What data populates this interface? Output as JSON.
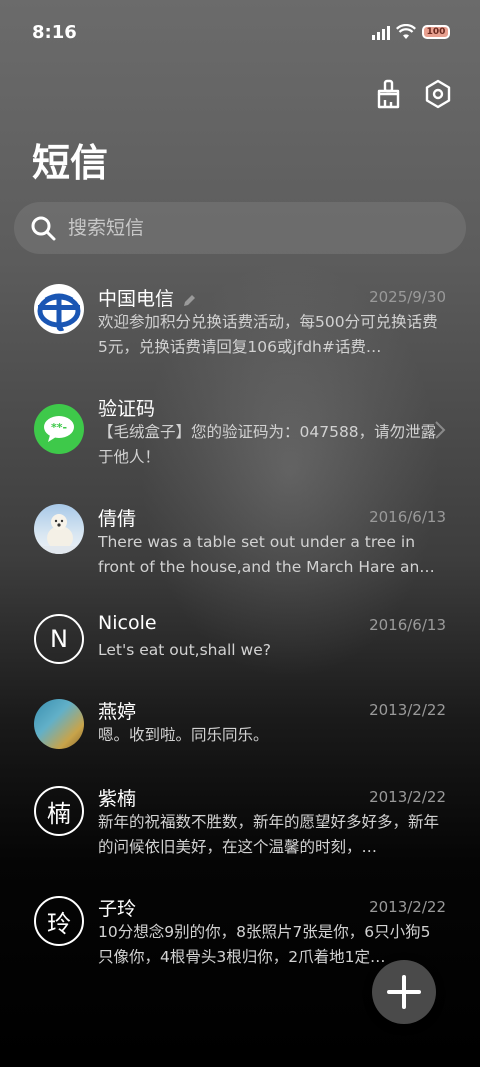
{
  "status_bar": {
    "time": "8:16",
    "battery": "100"
  },
  "header": {
    "title": "短信"
  },
  "search": {
    "placeholder": "搜索短信"
  },
  "conversations": [
    {
      "name": "中国电信",
      "date": "2025/9/30",
      "snippet": "欢迎参加积分兑换话费活动，每500分可兑换话费5元，兑换话费请回复106或jfdh#话费…",
      "avatar": "china-telecom-logo"
    },
    {
      "name": "验证码",
      "date": "",
      "snippet": "【毛绒盒子】您的验证码为：047588，请勿泄露于他人！",
      "avatar": "sms-code-icon"
    },
    {
      "name": "倩倩",
      "date": "2016/6/13",
      "snippet": "There was a table set out under a tree in front of the house,and the March Hare an…",
      "avatar": "polar-bear-photo"
    },
    {
      "name": "Nicole",
      "date": "2016/6/13",
      "snippet": "Let's eat out,shall we?",
      "avatar_letter": "N"
    },
    {
      "name": "燕婷",
      "date": "2013/2/22",
      "snippet": "嗯。收到啦。同乐同乐。",
      "avatar": "landscape-photo"
    },
    {
      "name": "紫楠",
      "date": "2013/2/22",
      "snippet": "新年的祝福数不胜数，新年的愿望好多好多，新年的问候依旧美好，在这个温馨的时刻，…",
      "avatar_letter": "楠"
    },
    {
      "name": "子玲",
      "date": "2013/2/22",
      "snippet": "10分想念9别的你，8张照片7张是你，6只小狗5只像你，4根骨头3根归你，2爪着地1定…",
      "avatar_letter": "玲"
    }
  ],
  "colors": {
    "accent_green": "#3ec94a",
    "telecom_blue": "#1a56b4"
  }
}
